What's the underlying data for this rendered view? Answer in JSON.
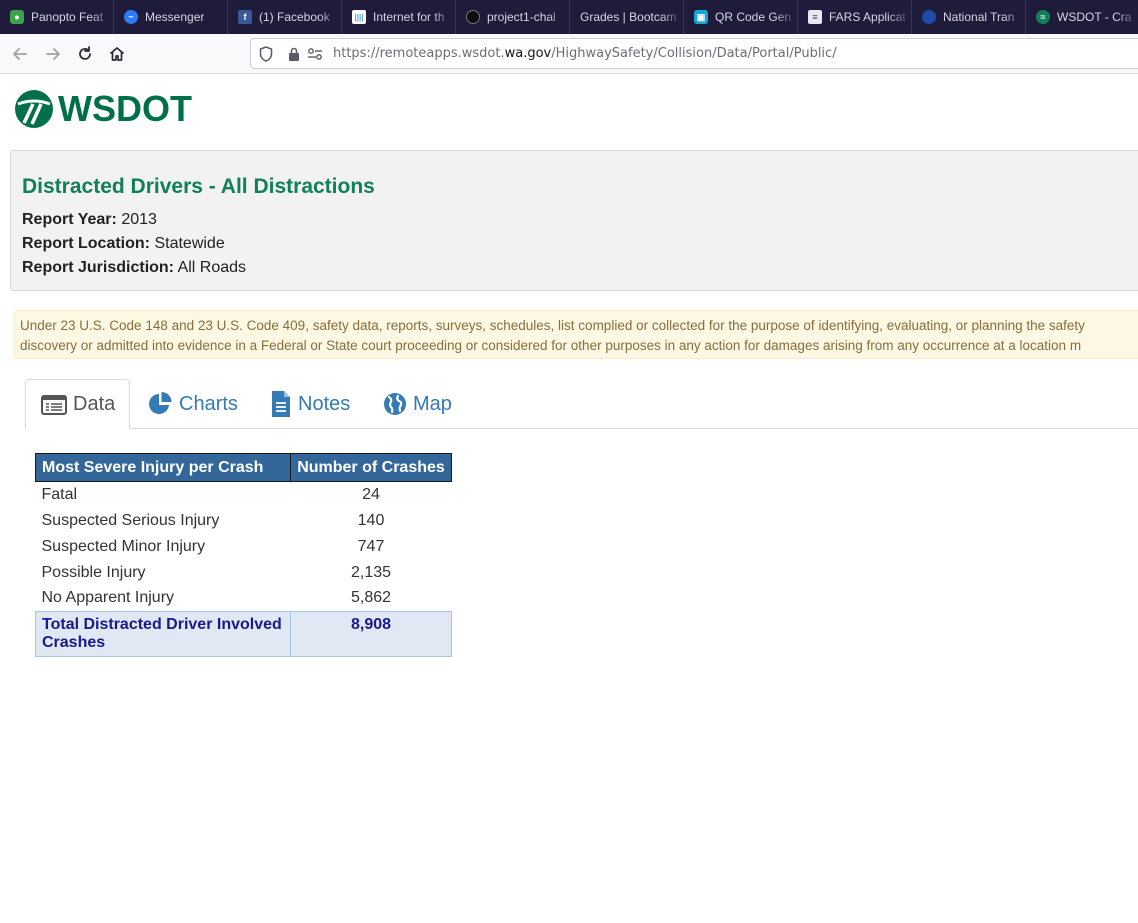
{
  "browser": {
    "tabs": [
      {
        "title": "Panopto Feat",
        "icon": "panopto-icon",
        "color": "#3aa34b"
      },
      {
        "title": "Messenger",
        "icon": "messenger-icon",
        "color": "#2d7cf6"
      },
      {
        "title": "(1) Facebook",
        "icon": "facebook-icon",
        "color": "#3b5998"
      },
      {
        "title": "Internet for th",
        "icon": "cisco-icon",
        "color": "#4aa3df"
      },
      {
        "title": "project1-chal",
        "icon": "github-icon",
        "color": "#24292e"
      },
      {
        "title": "Grades | Bootcam",
        "icon": "",
        "color": ""
      },
      {
        "title": "QR Code Gen",
        "icon": "qr-icon",
        "color": "#1aa3d4"
      },
      {
        "title": "FARS Applicat",
        "icon": "document-icon",
        "color": "#e8e8f0"
      },
      {
        "title": "National Tran",
        "icon": "nhtsa-icon",
        "color": "#1e4aa8"
      },
      {
        "title": "WSDOT - Cra",
        "icon": "wsdot-icon",
        "color": "#10805a"
      }
    ],
    "url_prefix": "https://remoteapps.wsdot.",
    "url_host": "wa.gov",
    "url_suffix": "/HighwaySafety/Collision/Data/Portal/Public/"
  },
  "logo": {
    "text": "WSDOT"
  },
  "report": {
    "title": "Distracted Drivers - All Distractions",
    "year_label": "Report Year:",
    "year_value": "2013",
    "location_label": "Report Location:",
    "location_value": "Statewide",
    "jurisdiction_label": "Report Jurisdiction:",
    "jurisdiction_value": "All Roads"
  },
  "disclaimer": {
    "line1": "Under 23 U.S. Code 148 and 23 U.S. Code 409, safety data, reports, surveys, schedules, list complied or collected for the purpose of identifying, evaluating, or planning the safety",
    "line2": "discovery or admitted into evidence in a Federal or State court proceeding or considered for other purposes in any action for damages arising from any occurrence at a location m"
  },
  "page_tabs": [
    {
      "label": "Data",
      "icon": "table-icon",
      "active": true
    },
    {
      "label": "Charts",
      "icon": "pie-chart-icon",
      "active": false
    },
    {
      "label": "Notes",
      "icon": "document-icon",
      "active": false
    },
    {
      "label": "Map",
      "icon": "globe-icon",
      "active": false
    }
  ],
  "table": {
    "headers": [
      "Most Severe Injury per Crash",
      "Number of Crashes"
    ],
    "rows": [
      {
        "label": "Fatal",
        "value": "24"
      },
      {
        "label": "Suspected Serious Injury",
        "value": "140"
      },
      {
        "label": "Suspected Minor Injury",
        "value": "747"
      },
      {
        "label": "Possible Injury",
        "value": "2,135"
      },
      {
        "label": "No Apparent Injury",
        "value": "5,862"
      }
    ],
    "total": {
      "label": "Total Distracted Driver Involved Crashes",
      "value": "8,908"
    }
  }
}
